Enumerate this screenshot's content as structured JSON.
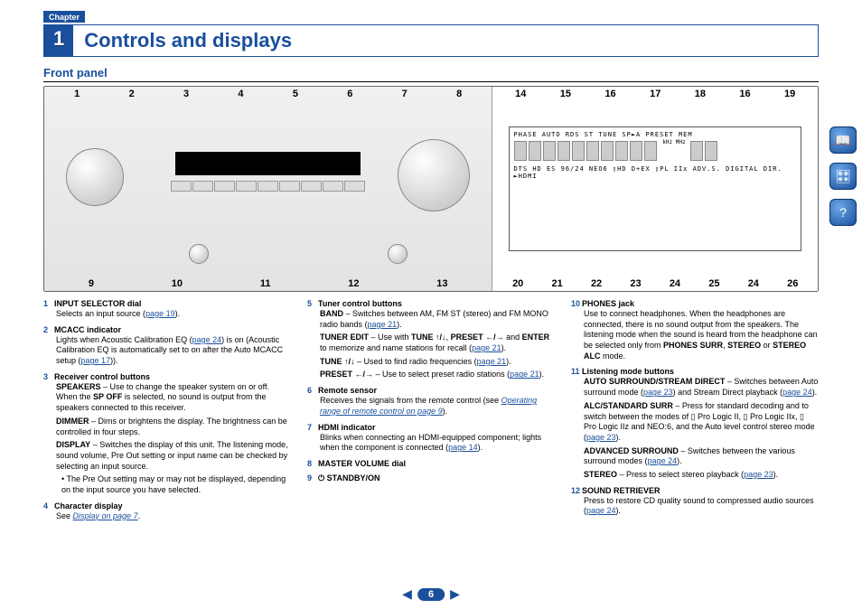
{
  "chapter": {
    "label": "Chapter",
    "number": "1",
    "title": "Controls and displays"
  },
  "section": "Front panel",
  "callouts": {
    "receiver_top": [
      "1",
      "2",
      "3",
      "4",
      "5",
      "6",
      "7",
      "8"
    ],
    "receiver_bottom": [
      "9",
      "10",
      "11",
      "12",
      "13"
    ],
    "display_top": [
      "14",
      "15",
      "16",
      "17",
      "18",
      "16",
      "19"
    ],
    "display_bottom": [
      "20",
      "21",
      "22",
      "23",
      "24",
      "25",
      "24",
      "26"
    ]
  },
  "lcd_indicators_top": "PHASE  AUTO  RDS     ST TUNE        SP►A    PRESET MEM",
  "lcd_indicators_bot": "DTS HD ES 96/24 NEO6 ▯HD D+EX ▯PL IIx ADV.S. DIGITAL  DIR. ►HDMI",
  "lcd_units": "kHz MHz",
  "items": {
    "i1": {
      "title": "INPUT SELECTOR dial",
      "body": "Selects an input source (",
      "link": "page 19",
      "after": ")."
    },
    "i2": {
      "title": "MCACC indicator",
      "body": "Lights when Acoustic Calibration EQ (",
      "link": "page 24",
      "after": ") is on (Acoustic Calibration EQ is automatically set to on after the Auto MCACC setup (",
      "link2": "page 17",
      "after2": "))."
    },
    "i3": {
      "title": "Receiver control buttons",
      "p1a": "SPEAKERS",
      "p1b": " – Use to change the speaker system on or off. When the ",
      "p1c": "SP OFF",
      "p1d": " is selected, no sound is output from the speakers connected to this receiver.",
      "p2a": "DIMMER",
      "p2b": " – Dims or brightens the display. The brightness can be controlled in four steps.",
      "p3a": "DISPLAY",
      "p3b": " – Switches the display of this unit. The listening mode, sound volume, Pre Out setting or input name can be checked by selecting an input source.",
      "p4": "• The Pre Out setting may or may not be displayed, depending on the input source you have selected."
    },
    "i4": {
      "title": "Character display",
      "body": "See ",
      "link": "Display on page 7",
      "after": "."
    },
    "i5": {
      "title": "Tuner control buttons",
      "p1a": "BAND",
      "p1b": " – Switches between AM, FM ST (stereo) and FM MONO radio bands (",
      "link1": "page 21",
      "p1c": ").",
      "p2a": "TUNER EDIT",
      "p2b": " – Use with ",
      "p2c": "TUNE ↑/↓",
      "p2d": ", ",
      "p2e": "PRESET ←/→",
      "p2f": " and ",
      "p2g": "ENTER",
      "p2h": " to memorize and name stations for recall (",
      "link2": "page 21",
      "p2i": ").",
      "p3a": "TUNE ↑/↓",
      "p3b": " – Used to find radio frequencies (",
      "link3": "page 21",
      "p3c": ").",
      "p4a": "PRESET ←/→",
      "p4b": " – Use to select preset radio stations (",
      "link4": "page 21",
      "p4c": ")."
    },
    "i6": {
      "title": "Remote sensor",
      "body": "Receives the signals from the remote control (see ",
      "link": "Operating range of remote control on page 9",
      "after": ")."
    },
    "i7": {
      "title": "HDMI indicator",
      "body": "Blinks when connecting an HDMI-equipped component; lights when the component is connected (",
      "link": "page 14",
      "after": ")."
    },
    "i8": {
      "title": "MASTER VOLUME dial"
    },
    "i9": {
      "title": "⏻ STANDBY/ON"
    },
    "i10": {
      "title": "PHONES jack",
      "body": "Use to connect headphones. When the headphones are connected, there is no sound output from the speakers. The listening mode when the sound is heard from the headphone can be selected only from ",
      "b1": "PHONES SURR",
      "mid1": ", ",
      "b2": "STEREO",
      "mid2": " or ",
      "b3": "STEREO ALC",
      "after": " mode."
    },
    "i11": {
      "title": "Listening mode buttons",
      "p1a": "AUTO SURROUND/STREAM DIRECT",
      "p1b": " – Switches between Auto surround mode (",
      "link1": "page 23",
      "p1c": ") and Stream Direct playback (",
      "link1b": "page 24",
      "p1d": ").",
      "p2a": "ALC/STANDARD SURR",
      "p2b": " – Press for standard decoding and to switch between the modes of ▯ Pro Logic II, ▯ Pro Logic IIx, ▯ Pro Logic IIz and NEO:6, and the Auto level control stereo mode (",
      "link2": "page 23",
      "p2c": ").",
      "p3a": "ADVANCED SURROUND",
      "p3b": " – Switches between the various surround modes (",
      "link3": "page 24",
      "p3c": ").",
      "p4a": "STEREO",
      "p4b": " – Press to select stereo playback (",
      "link4": "page 23",
      "p4c": ")."
    },
    "i12": {
      "title": "SOUND RETRIEVER",
      "body": "Press to restore CD quality sound to compressed audio sources (",
      "link": "page 24",
      "after": ")."
    }
  },
  "pager": {
    "page": "6"
  }
}
